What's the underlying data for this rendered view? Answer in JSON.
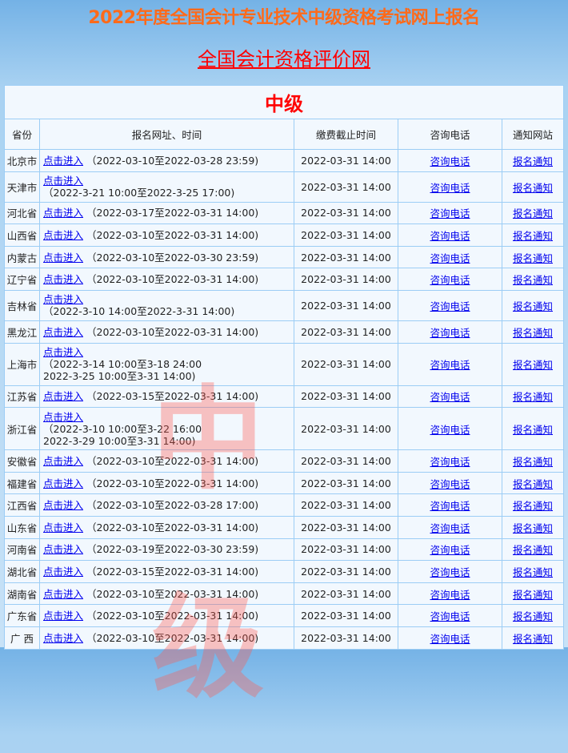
{
  "title": "2022年度全国会计专业技术中级资格考试网上报名",
  "site_link": "全国会计资格评价网",
  "level": "中级",
  "watermark": "中级",
  "headers": [
    "省份",
    "报名网址、时间",
    "缴费截止时间",
    "咨询电话",
    "通知网站"
  ],
  "link_label": "点击进入",
  "phone_label": "咨询电话",
  "notice_label": "报名通知",
  "rows": [
    {
      "province": "北京市",
      "time": "（2022-03-10至2022-03-28 23:59)",
      "break": false,
      "deadline": "2022-03-31 14:00"
    },
    {
      "province": "天津市",
      "time": "（2022-3-21 10:00至2022-3-25 17:00)",
      "break": true,
      "deadline": "2022-03-31 14:00"
    },
    {
      "province": "河北省",
      "time": "（2022-03-17至2022-03-31 14:00)",
      "break": false,
      "deadline": "2022-03-31 14:00"
    },
    {
      "province": "山西省",
      "time": "（2022-03-10至2022-03-31 14:00)",
      "break": false,
      "deadline": "2022-03-31 14:00"
    },
    {
      "province": "内蒙古",
      "time": "（2022-03-10至2022-03-30 23:59)",
      "break": false,
      "deadline": "2022-03-31 14:00"
    },
    {
      "province": "辽宁省",
      "time": "（2022-03-10至2022-03-31 14:00)",
      "break": false,
      "deadline": "2022-03-31 14:00"
    },
    {
      "province": "吉林省",
      "time": "（2022-3-10 14:00至2022-3-31 14:00)",
      "break": true,
      "deadline": "2022-03-31 14:00"
    },
    {
      "province": "黑龙江",
      "time": "（2022-03-10至2022-03-31 14:00)",
      "break": false,
      "deadline": "2022-03-31 14:00"
    },
    {
      "province": "上海市",
      "time": "（2022-3-14 10:00至3-18 24:00",
      "time2": "2022-3-25 10:00至3-31 14:00)",
      "break": true,
      "deadline": "2022-03-31 14:00"
    },
    {
      "province": "江苏省",
      "time": "（2022-03-15至2022-03-31 14:00)",
      "break": false,
      "deadline": "2022-03-31 14:00"
    },
    {
      "province": "浙江省",
      "time": "（2022-3-10 10:00至3-22 16:00",
      "time2": "2022-3-29 10:00至3-31 14:00)",
      "break": true,
      "deadline": "2022-03-31 14:00"
    },
    {
      "province": "安徽省",
      "time": "（2022-03-10至2022-03-31 14:00)",
      "break": false,
      "deadline": "2022-03-31 14:00"
    },
    {
      "province": "福建省",
      "time": "（2022-03-10至2022-03-31 14:00)",
      "break": false,
      "deadline": "2022-03-31 14:00"
    },
    {
      "province": "江西省",
      "time": "（2022-03-10至2022-03-28 17:00)",
      "break": false,
      "deadline": "2022-03-31 14:00"
    },
    {
      "province": "山东省",
      "time": "（2022-03-10至2022-03-31 14:00)",
      "break": false,
      "deadline": "2022-03-31 14:00"
    },
    {
      "province": "河南省",
      "time": "（2022-03-19至2022-03-30 23:59)",
      "break": false,
      "deadline": "2022-03-31 14:00"
    },
    {
      "province": "湖北省",
      "time": "（2022-03-15至2022-03-31 14:00)",
      "break": false,
      "deadline": "2022-03-31 14:00"
    },
    {
      "province": "湖南省",
      "time": "（2022-03-10至2022-03-31 14:00)",
      "break": false,
      "deadline": "2022-03-31 14:00"
    },
    {
      "province": "广东省",
      "time": "（2022-03-10至2022-03-31 14:00)",
      "break": false,
      "deadline": "2022-03-31 14:00"
    },
    {
      "province": "广 西",
      "time": "（2022-03-10至2022-03-31 14:00)",
      "break": false,
      "deadline": "2022-03-31 14:00"
    }
  ]
}
